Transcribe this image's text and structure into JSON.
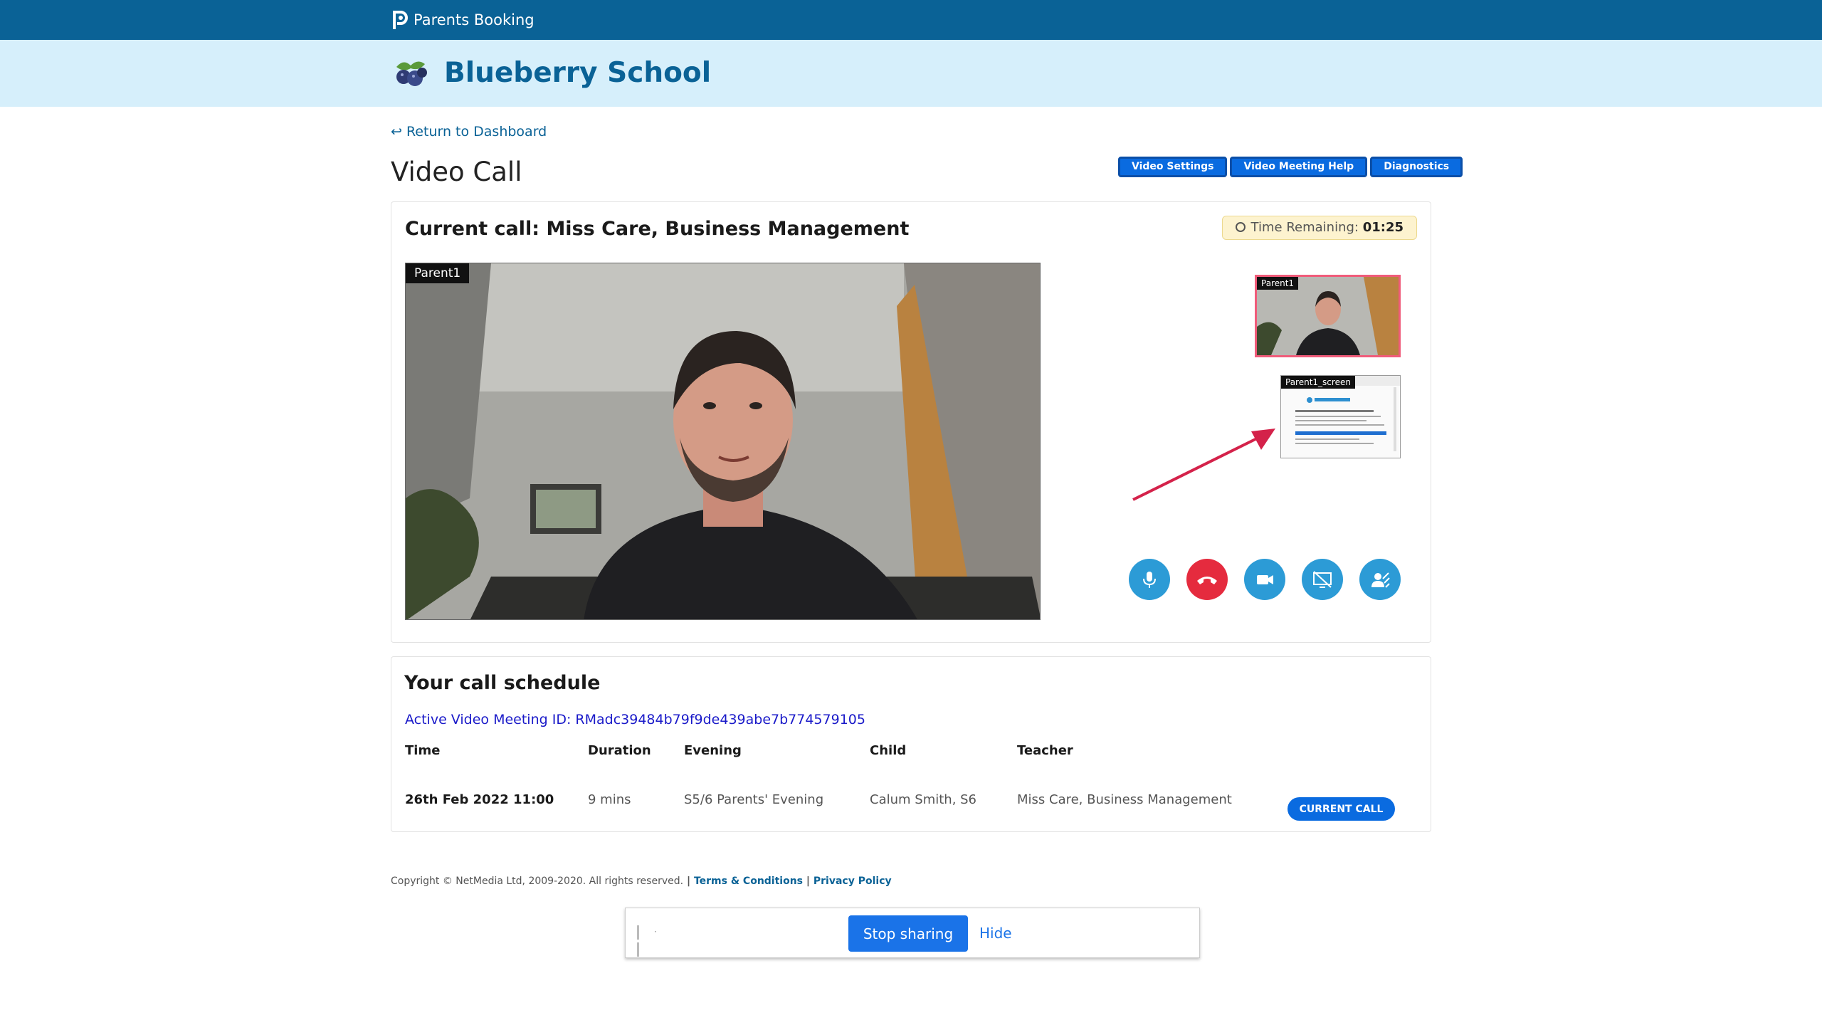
{
  "app": {
    "name": "Parents Booking"
  },
  "school": {
    "name": "Blueberry School"
  },
  "nav": {
    "return_label": "↩ Return to Dashboard"
  },
  "page": {
    "title": "Video Call"
  },
  "toolbar": {
    "video_settings": "Video Settings",
    "meeting_help": "Video Meeting Help",
    "diagnostics": "Diagnostics"
  },
  "call": {
    "title": "Current call: Miss Care, Business Management",
    "timer_label": "Time Remaining:",
    "timer_value": "01:25",
    "main_video_label": "Parent1",
    "thumb1_label": "Parent1",
    "thumb2_label": "Parent1_screen"
  },
  "controls": [
    {
      "name": "microphone-button",
      "icon": "microphone-icon",
      "color": "#2c9bd6"
    },
    {
      "name": "hang-up-button",
      "icon": "phone-hangup-icon",
      "color": "#e52b3e"
    },
    {
      "name": "camera-button",
      "icon": "camera-icon",
      "color": "#2c9bd6"
    },
    {
      "name": "screen-share-off-button",
      "icon": "screen-share-off-icon",
      "color": "#2c9bd6"
    },
    {
      "name": "blur-background-button",
      "icon": "background-blur-icon",
      "color": "#2c9bd6"
    }
  ],
  "schedule": {
    "title": "Your call schedule",
    "meeting_id": "Active Video Meeting ID: RMadc39484b79f9de439abe7b774579105",
    "headers": [
      "Time",
      "Duration",
      "Evening",
      "Child",
      "Teacher"
    ],
    "rows": [
      {
        "time": "26th Feb 2022 11:00",
        "duration": "9 mins",
        "evening": "S5/6 Parents' Evening",
        "child": "Calum Smith, S6",
        "teacher": "Miss Care, Business Management",
        "action": "CURRENT CALL"
      }
    ]
  },
  "footer": {
    "copyright": "Copyright © NetMedia Ltd, 2009-2020. All rights reserved.",
    "sep": " | ",
    "terms": "Terms & Conditions",
    "privacy": "Privacy Policy"
  },
  "share_bar": {
    "dot": "·",
    "stop_label": "Stop sharing",
    "hide_label": "Hide"
  },
  "colors": {
    "topbar": "#0a6296",
    "schoolbar": "#d6effb",
    "primary_button": "#0a6be0",
    "control_blue": "#2c9bd6",
    "control_red": "#e52b3e",
    "active_thumb_border": "#f05b7a",
    "arrow": "#d4224a"
  }
}
